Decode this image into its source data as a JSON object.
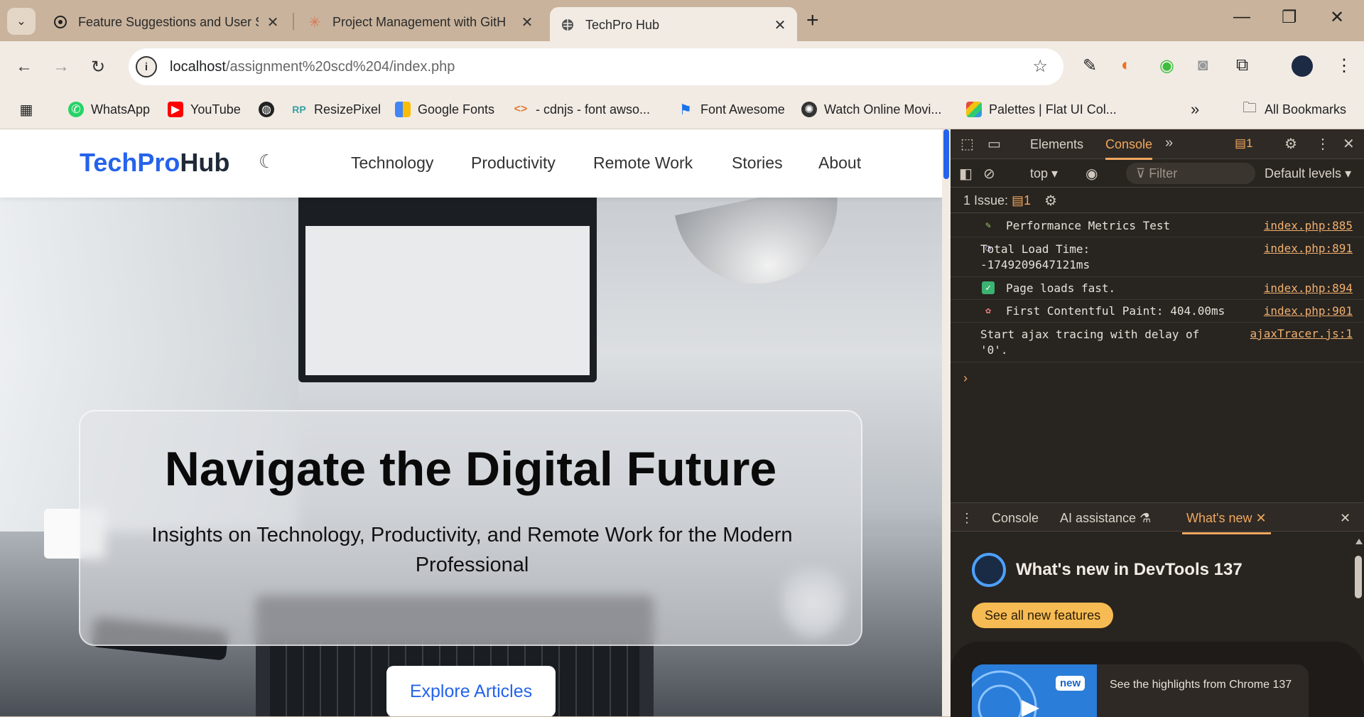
{
  "browser": {
    "tabs": [
      {
        "title": "Feature Suggestions and User S",
        "active": false
      },
      {
        "title": "Project Management with GitH",
        "active": false
      },
      {
        "title": "TechPro Hub",
        "active": true
      }
    ],
    "url_host": "localhost",
    "url_path": "/assignment%20scd%204/index.php",
    "bookmarks": [
      {
        "label": "WhatsApp",
        "icon": "whatsapp-icon",
        "color": "#25d366"
      },
      {
        "label": "YouTube",
        "icon": "youtube-icon",
        "color": "#ff0000"
      },
      {
        "label": "",
        "icon": "globe-icon",
        "color": "#222222"
      },
      {
        "label": "ResizePixel",
        "icon": "resizepixel-icon",
        "color": "#3aa0a0"
      },
      {
        "label": "Google Fonts",
        "icon": "google-fonts-icon",
        "color": "#4285f4"
      },
      {
        "label": "- cdnjs - font awso...",
        "icon": "code-icon",
        "color": "#e07b39"
      },
      {
        "label": "Font Awesome",
        "icon": "flag-icon",
        "color": "#1a73e8"
      },
      {
        "label": "Watch Online Movi...",
        "icon": "film-icon",
        "color": "#333333"
      },
      {
        "label": "Palettes | Flat UI Col...",
        "icon": "palette-icon",
        "color": "#e74c3c"
      }
    ],
    "all_bookmarks": "All Bookmarks"
  },
  "site": {
    "logo_a": "TechPro",
    "logo_b": "Hub",
    "nav": [
      "Technology",
      "Productivity",
      "Remote Work",
      "Stories",
      "About"
    ],
    "hero_title": "Navigate the Digital Future",
    "hero_subtitle": "Insights on Technology, Productivity, and Remote Work for the Modern Professional",
    "cta": "Explore Articles",
    "brand_color": "#2563eb"
  },
  "devtools": {
    "tabs": [
      "Elements",
      "Console"
    ],
    "active_tab": "Console",
    "issues_badge": "1",
    "context": "top",
    "filter_placeholder": "Filter",
    "levels": "Default levels",
    "issues_label": "1 Issue:",
    "issues_count": "1",
    "logs": [
      {
        "icon": "pencil-icon",
        "message": "Performance Metrics Test",
        "source": "index.php:885"
      },
      {
        "icon": "stopwatch-icon",
        "message": "Total Load Time:\n-1749209647121ms",
        "source": "index.php:891"
      },
      {
        "icon": "check-icon",
        "message": "Page loads fast.",
        "source": "index.php:894"
      },
      {
        "icon": "palette-icon",
        "message": "First Contentful Paint: 404.00ms",
        "source": "index.php:901"
      },
      {
        "icon": "",
        "message": "Start ajax tracing with delay of\n'0'.",
        "source": "ajaxTracer.js:1"
      }
    ],
    "drawer_tabs": [
      "Console",
      "AI assistance",
      "What's new"
    ],
    "whats_new_title": "What's new in DevTools 137",
    "whats_new_button": "See all new features",
    "whats_new_badge": "new",
    "whats_new_card": "See the highlights from Chrome 137",
    "accent": "#f0a860"
  }
}
